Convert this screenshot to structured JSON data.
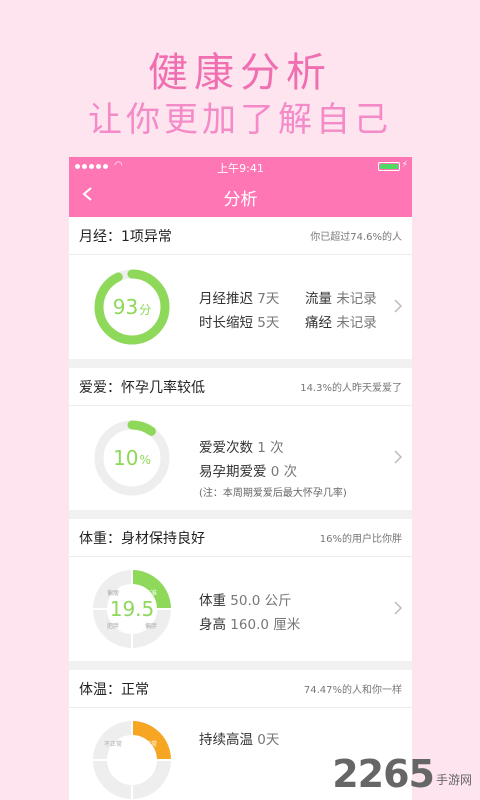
{
  "promo": {
    "line1": "健康分析",
    "line2": "让你更加了解自己"
  },
  "status_bar": {
    "time": "上午9:41",
    "wifi_icon": "wifi-icon",
    "battery_icon": "battery-icon"
  },
  "nav": {
    "title": "分析",
    "back_icon": "chevron-left-icon"
  },
  "sections": {
    "menstrual": {
      "title": "月经：1项异常",
      "note": "你已超过74.6%的人",
      "score": {
        "value": "93",
        "unit": "分",
        "fraction": 0.93
      },
      "items": [
        {
          "label": "月经推迟",
          "value": "7天"
        },
        {
          "label": "流量",
          "value": "未记录"
        },
        {
          "label": "时长缩短",
          "value": "5天"
        },
        {
          "label": "痛经",
          "value": "未记录"
        }
      ]
    },
    "love": {
      "title": "爱爱：怀孕几率较低",
      "note": "14.3%的人昨天爱爱了",
      "percent": {
        "value": "10",
        "unit": "%",
        "fraction": 0.1
      },
      "items": [
        {
          "label": "爱爱次数",
          "value": "1 次"
        },
        {
          "label": "易孕期爱爱",
          "value": "0 次"
        }
      ],
      "footnote": "(注：本周期爱爱后最大怀孕几率)"
    },
    "weight": {
      "title": "体重：身材保持良好",
      "note": "16%的用户比你胖",
      "bmi": "19.5",
      "ring_labels": [
        "偏瘦",
        "标准",
        "偏胖",
        "肥胖"
      ],
      "items": [
        {
          "label": "体重",
          "value": "50.0 公斤"
        },
        {
          "label": "身高",
          "value": "160.0 厘米"
        }
      ]
    },
    "temperature": {
      "title": "体温：正常",
      "note": "74.47%的人和你一样",
      "ring_labels": [
        "不正常",
        "正常"
      ],
      "items": [
        {
          "label": "持续高温",
          "value": "0天"
        }
      ]
    }
  },
  "colors": {
    "brand": "#ff76b5",
    "ring_green": "#8ed85a",
    "ring_gray": "#eeeeee",
    "ring_orange": "#f6a623"
  },
  "watermark": {
    "number": "2265",
    "text": "手游网"
  }
}
